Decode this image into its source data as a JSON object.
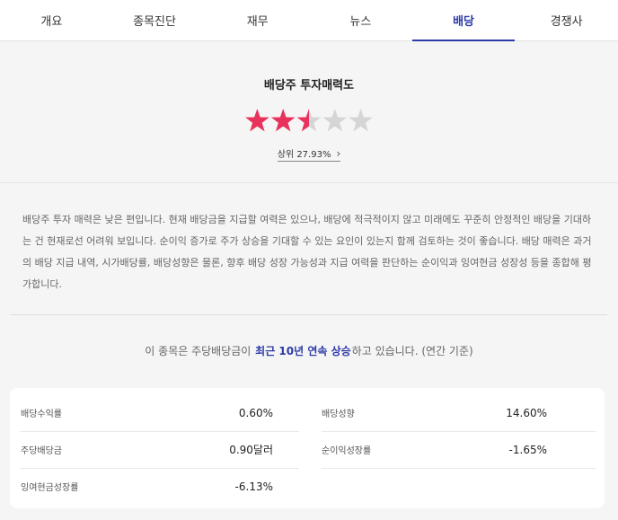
{
  "tabs": [
    {
      "label": "개요"
    },
    {
      "label": "종목진단"
    },
    {
      "label": "재무"
    },
    {
      "label": "뉴스"
    },
    {
      "label": "배당",
      "active": true
    },
    {
      "label": "경쟁사"
    }
  ],
  "rating": {
    "title": "배당주 투자매력도",
    "stars_filled": 2.5,
    "stars_total": 5,
    "rank_text": "상위 27.93%",
    "colors": {
      "filled": "#e8315b",
      "empty": "#d5d5d5"
    }
  },
  "description": "배당주 투자 매력은 낮은 편입니다. 현재 배당금을 지급할 여력은 있으나, 배당에 적극적이지 않고 미래에도 꾸준히 안정적인 배당을 기대하는 건 현재로선 어려워 보입니다. 순이익 증가로 주가 상승을 기대할 수 있는 요인이 있는지 함께 검토하는 것이 좋습니다. 배당 매력은 과거의 배당 지급 내역, 시가배당률, 배당성향은 물론, 향후 배당 성장 가능성과 지급 여력을 판단하는 순이익과 잉여현금 성장성 등을 종합해 평가합니다.",
  "streak": {
    "prefix": "이 종목은 주당배당금이",
    "highlight": "최근 10년 연속 상승",
    "suffix": "하고 있습니다. (연간 기준)"
  },
  "metrics": {
    "rows": [
      {
        "left": {
          "label": "배당수익률",
          "value": "0.60%"
        },
        "right": {
          "label": "배당성향",
          "value": "14.60%"
        }
      },
      {
        "left": {
          "label": "주당배당금",
          "value": "0.90달러"
        },
        "right": {
          "label": "순이익성장률",
          "value": "-1.65%"
        }
      },
      {
        "left": {
          "label": "잉여현금성장률",
          "value": "-6.13%"
        }
      }
    ]
  }
}
